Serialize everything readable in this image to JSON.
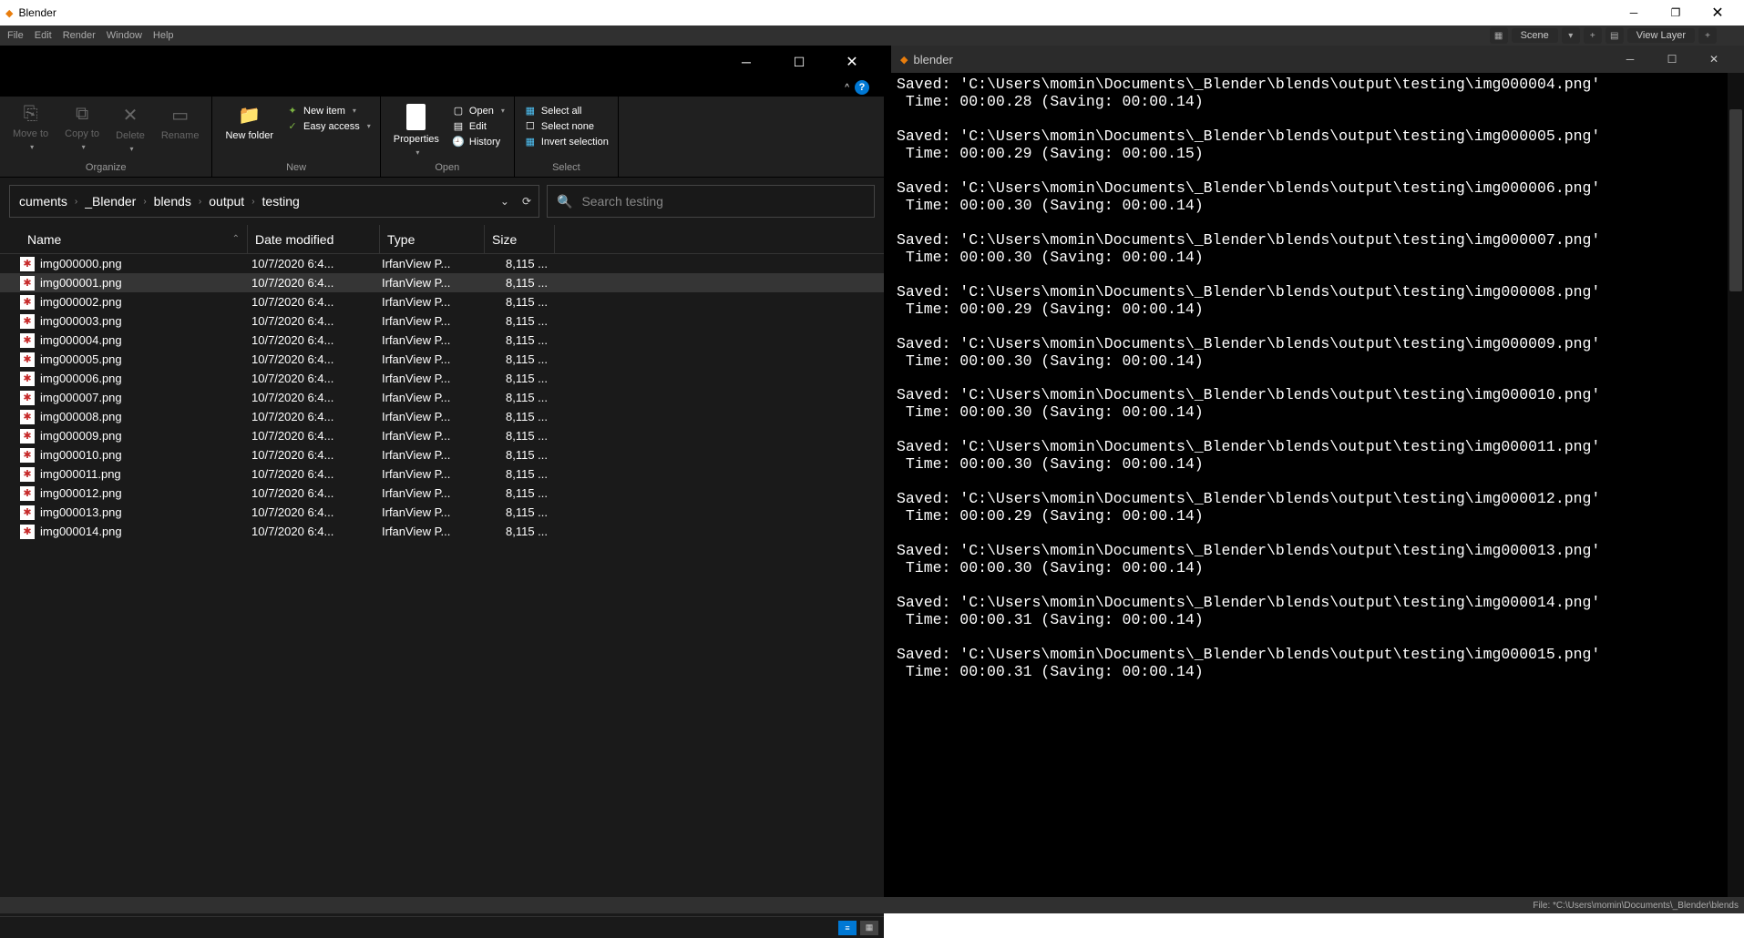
{
  "blender": {
    "title": "Blender",
    "menus": [
      "File",
      "Edit",
      "Render",
      "Window",
      "Help"
    ],
    "scene": "Scene",
    "viewlayer": "View Layer",
    "statusbar": "File: *C:\\Users\\momin\\Documents\\_Blender\\blends"
  },
  "explorer": {
    "ribbon": {
      "organize": {
        "label": "Organize",
        "move_to": "Move to",
        "copy_to": "Copy to",
        "delete": "Delete",
        "rename": "Rename"
      },
      "new": {
        "label": "New",
        "new_folder": "New folder",
        "new_item": "New item",
        "easy_access": "Easy access"
      },
      "open": {
        "label": "Open",
        "properties": "Properties",
        "open": "Open",
        "edit": "Edit",
        "history": "History"
      },
      "select": {
        "label": "Select",
        "select_all": "Select all",
        "select_none": "Select none",
        "invert": "Invert selection"
      }
    },
    "breadcrumbs": [
      "cuments",
      "_Blender",
      "blends",
      "output",
      "testing"
    ],
    "search_placeholder": "Search testing",
    "columns": {
      "name": "Name",
      "date": "Date modified",
      "type": "Type",
      "size": "Size"
    },
    "files": [
      {
        "name": "img000000.png",
        "date": "10/7/2020 6:4...",
        "type": "IrfanView P...",
        "size": "8,115 ...",
        "selected": false
      },
      {
        "name": "img000001.png",
        "date": "10/7/2020 6:4...",
        "type": "IrfanView P...",
        "size": "8,115 ...",
        "selected": true
      },
      {
        "name": "img000002.png",
        "date": "10/7/2020 6:4...",
        "type": "IrfanView P...",
        "size": "8,115 ...",
        "selected": false
      },
      {
        "name": "img000003.png",
        "date": "10/7/2020 6:4...",
        "type": "IrfanView P...",
        "size": "8,115 ...",
        "selected": false
      },
      {
        "name": "img000004.png",
        "date": "10/7/2020 6:4...",
        "type": "IrfanView P...",
        "size": "8,115 ...",
        "selected": false
      },
      {
        "name": "img000005.png",
        "date": "10/7/2020 6:4...",
        "type": "IrfanView P...",
        "size": "8,115 ...",
        "selected": false
      },
      {
        "name": "img000006.png",
        "date": "10/7/2020 6:4...",
        "type": "IrfanView P...",
        "size": "8,115 ...",
        "selected": false
      },
      {
        "name": "img000007.png",
        "date": "10/7/2020 6:4...",
        "type": "IrfanView P...",
        "size": "8,115 ...",
        "selected": false
      },
      {
        "name": "img000008.png",
        "date": "10/7/2020 6:4...",
        "type": "IrfanView P...",
        "size": "8,115 ...",
        "selected": false
      },
      {
        "name": "img000009.png",
        "date": "10/7/2020 6:4...",
        "type": "IrfanView P...",
        "size": "8,115 ...",
        "selected": false
      },
      {
        "name": "img000010.png",
        "date": "10/7/2020 6:4...",
        "type": "IrfanView P...",
        "size": "8,115 ...",
        "selected": false
      },
      {
        "name": "img000011.png",
        "date": "10/7/2020 6:4...",
        "type": "IrfanView P...",
        "size": "8,115 ...",
        "selected": false
      },
      {
        "name": "img000012.png",
        "date": "10/7/2020 6:4...",
        "type": "IrfanView P...",
        "size": "8,115 ...",
        "selected": false
      },
      {
        "name": "img000013.png",
        "date": "10/7/2020 6:4...",
        "type": "IrfanView P...",
        "size": "8,115 ...",
        "selected": false
      },
      {
        "name": "img000014.png",
        "date": "10/7/2020 6:4...",
        "type": "IrfanView P...",
        "size": "8,115 ...",
        "selected": false
      }
    ]
  },
  "console": {
    "title": "blender",
    "lines": [
      "Saved: 'C:\\Users\\momin\\Documents\\_Blender\\blends\\output\\testing\\img000004.png'",
      " Time: 00:00.28 (Saving: 00:00.14)",
      "",
      "Saved: 'C:\\Users\\momin\\Documents\\_Blender\\blends\\output\\testing\\img000005.png'",
      " Time: 00:00.29 (Saving: 00:00.15)",
      "",
      "Saved: 'C:\\Users\\momin\\Documents\\_Blender\\blends\\output\\testing\\img000006.png'",
      " Time: 00:00.30 (Saving: 00:00.14)",
      "",
      "Saved: 'C:\\Users\\momin\\Documents\\_Blender\\blends\\output\\testing\\img000007.png'",
      " Time: 00:00.30 (Saving: 00:00.14)",
      "",
      "Saved: 'C:\\Users\\momin\\Documents\\_Blender\\blends\\output\\testing\\img000008.png'",
      " Time: 00:00.29 (Saving: 00:00.14)",
      "",
      "Saved: 'C:\\Users\\momin\\Documents\\_Blender\\blends\\output\\testing\\img000009.png'",
      " Time: 00:00.30 (Saving: 00:00.14)",
      "",
      "Saved: 'C:\\Users\\momin\\Documents\\_Blender\\blends\\output\\testing\\img000010.png'",
      " Time: 00:00.30 (Saving: 00:00.14)",
      "",
      "Saved: 'C:\\Users\\momin\\Documents\\_Blender\\blends\\output\\testing\\img000011.png'",
      " Time: 00:00.30 (Saving: 00:00.14)",
      "",
      "Saved: 'C:\\Users\\momin\\Documents\\_Blender\\blends\\output\\testing\\img000012.png'",
      " Time: 00:00.29 (Saving: 00:00.14)",
      "",
      "Saved: 'C:\\Users\\momin\\Documents\\_Blender\\blends\\output\\testing\\img000013.png'",
      " Time: 00:00.30 (Saving: 00:00.14)",
      "",
      "Saved: 'C:\\Users\\momin\\Documents\\_Blender\\blends\\output\\testing\\img000014.png'",
      " Time: 00:00.31 (Saving: 00:00.14)",
      "",
      "Saved: 'C:\\Users\\momin\\Documents\\_Blender\\blends\\output\\testing\\img000015.png'",
      " Time: 00:00.31 (Saving: 00:00.14)",
      ""
    ]
  }
}
